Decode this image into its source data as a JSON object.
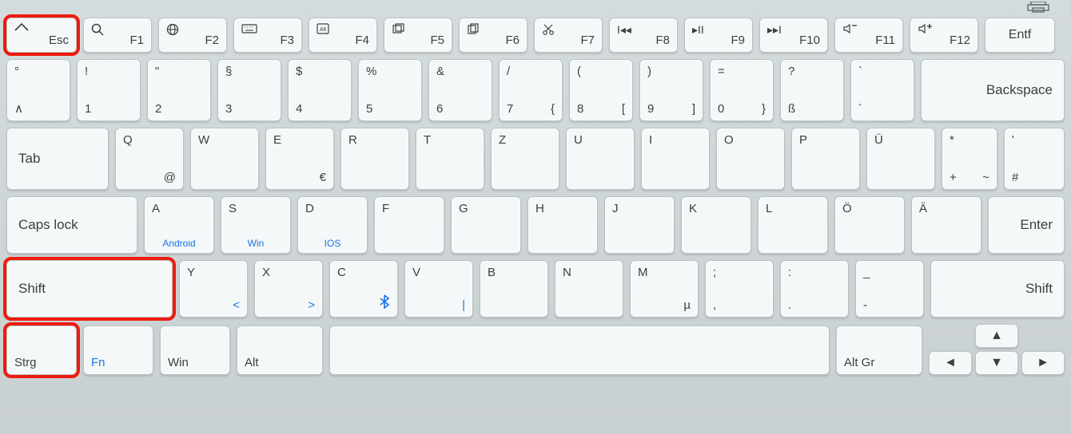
{
  "annotations": {
    "highlighted": [
      "esc",
      "shift-left",
      "strg"
    ]
  },
  "printer_icon": "printer-icon",
  "row_fn": {
    "esc": {
      "icon": "home-icon",
      "label": "Esc"
    },
    "f1": {
      "icon": "search-icon",
      "label": "F1"
    },
    "f2": {
      "icon": "globe-icon",
      "label": "F2"
    },
    "f3": {
      "icon": "keyboard-icon",
      "label": "F3"
    },
    "f4": {
      "icon": "alt-icon",
      "label": "F4"
    },
    "f5": {
      "icon": "screenshot-icon",
      "label": "F5"
    },
    "f6": {
      "icon": "copy-icon",
      "label": "F6"
    },
    "f7": {
      "icon": "cut-icon",
      "label": "F7"
    },
    "f8": {
      "icon": "prev-track-icon",
      "label": "F8"
    },
    "f9": {
      "icon": "play-pause-icon",
      "label": "F9"
    },
    "f10": {
      "icon": "next-track-icon",
      "label": "F10"
    },
    "f11": {
      "icon": "vol-down-icon",
      "label": "F11"
    },
    "f12": {
      "icon": "vol-up-icon",
      "label": "F12"
    },
    "entf": {
      "label": "Entf"
    }
  },
  "row_num": {
    "k0": {
      "top": "°",
      "bot": "∧"
    },
    "k1": {
      "top": "!",
      "bot": "1"
    },
    "k2": {
      "top": "\"",
      "bot": "2"
    },
    "k3": {
      "top": "§",
      "bot": "3"
    },
    "k4": {
      "top": "$",
      "bot": "4"
    },
    "k5": {
      "top": "%",
      "bot": "5"
    },
    "k6": {
      "top": "&",
      "bot": "6"
    },
    "k7": {
      "top": "/",
      "bot": "7",
      "br": "{"
    },
    "k8": {
      "top": "(",
      "bot": "8",
      "br": "["
    },
    "k9": {
      "top": ")",
      "bot": "9",
      "br": "]"
    },
    "k10": {
      "top": "=",
      "bot": "0",
      "br": "}"
    },
    "k11": {
      "top": "?",
      "bot": "ß"
    },
    "k12": {
      "top": "`",
      "bot": "´"
    },
    "backspace": {
      "label": "Backspace"
    }
  },
  "row_q": {
    "tab": {
      "label": "Tab"
    },
    "q": {
      "main": "Q",
      "alt": "@"
    },
    "w": {
      "main": "W"
    },
    "e": {
      "main": "E",
      "alt": "€"
    },
    "r": {
      "main": "R"
    },
    "t": {
      "main": "T"
    },
    "z": {
      "main": "Z"
    },
    "u": {
      "main": "U"
    },
    "i": {
      "main": "I"
    },
    "o": {
      "main": "O"
    },
    "p": {
      "main": "P"
    },
    "ue": {
      "main": "Ü"
    },
    "plus": {
      "top": "*",
      "bot": "+",
      "br": "~"
    },
    "hash": {
      "top": "'",
      "bot": "#"
    }
  },
  "row_a": {
    "caps": {
      "label": "Caps lock"
    },
    "a": {
      "main": "A",
      "sub": "Android"
    },
    "s": {
      "main": "S",
      "sub": "Win"
    },
    "d": {
      "main": "D",
      "sub": "IOS"
    },
    "f": {
      "main": "F"
    },
    "g": {
      "main": "G"
    },
    "h": {
      "main": "H"
    },
    "j": {
      "main": "J"
    },
    "k": {
      "main": "K"
    },
    "l": {
      "main": "L"
    },
    "oe": {
      "main": "Ö"
    },
    "ae": {
      "main": "Ä"
    },
    "enter": {
      "label": "Enter"
    }
  },
  "row_y": {
    "shiftL": {
      "label": "Shift"
    },
    "y": {
      "main": "Y",
      "alt": "<",
      "alt_color": "blue"
    },
    "x": {
      "main": "X",
      "alt": ">",
      "alt_color": "blue"
    },
    "c": {
      "main": "C",
      "alt_icon": "bluetooth-icon"
    },
    "v": {
      "main": "V",
      "alt": "|",
      "alt_color": "blue"
    },
    "b": {
      "main": "B"
    },
    "n": {
      "main": "N"
    },
    "m": {
      "main": "M",
      "alt": "µ"
    },
    "comma": {
      "top": ";",
      "bot": ","
    },
    "dot": {
      "top": ":",
      "bot": "."
    },
    "dash": {
      "top": "_",
      "bot": "-"
    },
    "shiftR": {
      "label": "Shift"
    }
  },
  "row_space": {
    "strg": {
      "label": "Strg"
    },
    "fn": {
      "label": "Fn"
    },
    "win": {
      "label": "Win"
    },
    "alt": {
      "label": "Alt"
    },
    "altgr": {
      "label": "Alt Gr"
    },
    "arrows": {
      "up": "▲",
      "down": "▼",
      "left": "◄",
      "right": "►"
    }
  }
}
